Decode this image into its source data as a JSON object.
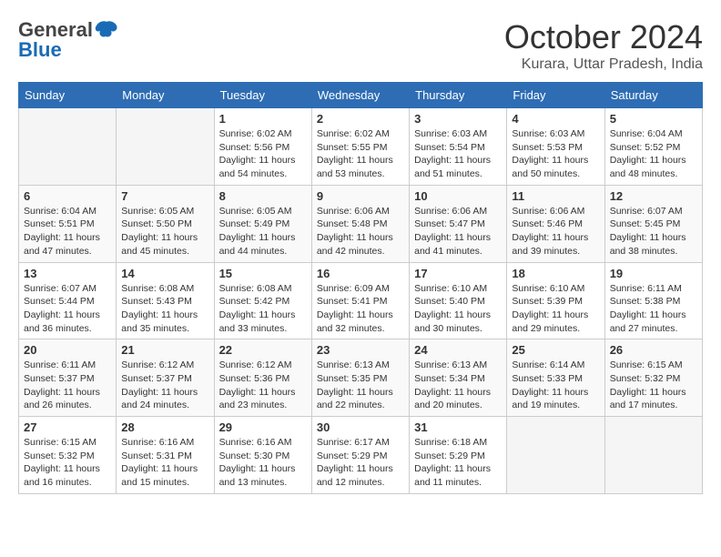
{
  "logo": {
    "general": "General",
    "blue": "Blue"
  },
  "title": "October 2024",
  "location": "Kurara, Uttar Pradesh, India",
  "weekdays": [
    "Sunday",
    "Monday",
    "Tuesday",
    "Wednesday",
    "Thursday",
    "Friday",
    "Saturday"
  ],
  "weeks": [
    [
      {
        "day": "",
        "empty": true
      },
      {
        "day": "",
        "empty": true
      },
      {
        "day": "1",
        "sunrise": "6:02 AM",
        "sunset": "5:56 PM",
        "daylight": "11 hours and 54 minutes."
      },
      {
        "day": "2",
        "sunrise": "6:02 AM",
        "sunset": "5:55 PM",
        "daylight": "11 hours and 53 minutes."
      },
      {
        "day": "3",
        "sunrise": "6:03 AM",
        "sunset": "5:54 PM",
        "daylight": "11 hours and 51 minutes."
      },
      {
        "day": "4",
        "sunrise": "6:03 AM",
        "sunset": "5:53 PM",
        "daylight": "11 hours and 50 minutes."
      },
      {
        "day": "5",
        "sunrise": "6:04 AM",
        "sunset": "5:52 PM",
        "daylight": "11 hours and 48 minutes."
      }
    ],
    [
      {
        "day": "6",
        "sunrise": "6:04 AM",
        "sunset": "5:51 PM",
        "daylight": "11 hours and 47 minutes."
      },
      {
        "day": "7",
        "sunrise": "6:05 AM",
        "sunset": "5:50 PM",
        "daylight": "11 hours and 45 minutes."
      },
      {
        "day": "8",
        "sunrise": "6:05 AM",
        "sunset": "5:49 PM",
        "daylight": "11 hours and 44 minutes."
      },
      {
        "day": "9",
        "sunrise": "6:06 AM",
        "sunset": "5:48 PM",
        "daylight": "11 hours and 42 minutes."
      },
      {
        "day": "10",
        "sunrise": "6:06 AM",
        "sunset": "5:47 PM",
        "daylight": "11 hours and 41 minutes."
      },
      {
        "day": "11",
        "sunrise": "6:06 AM",
        "sunset": "5:46 PM",
        "daylight": "11 hours and 39 minutes."
      },
      {
        "day": "12",
        "sunrise": "6:07 AM",
        "sunset": "5:45 PM",
        "daylight": "11 hours and 38 minutes."
      }
    ],
    [
      {
        "day": "13",
        "sunrise": "6:07 AM",
        "sunset": "5:44 PM",
        "daylight": "11 hours and 36 minutes."
      },
      {
        "day": "14",
        "sunrise": "6:08 AM",
        "sunset": "5:43 PM",
        "daylight": "11 hours and 35 minutes."
      },
      {
        "day": "15",
        "sunrise": "6:08 AM",
        "sunset": "5:42 PM",
        "daylight": "11 hours and 33 minutes."
      },
      {
        "day": "16",
        "sunrise": "6:09 AM",
        "sunset": "5:41 PM",
        "daylight": "11 hours and 32 minutes."
      },
      {
        "day": "17",
        "sunrise": "6:10 AM",
        "sunset": "5:40 PM",
        "daylight": "11 hours and 30 minutes."
      },
      {
        "day": "18",
        "sunrise": "6:10 AM",
        "sunset": "5:39 PM",
        "daylight": "11 hours and 29 minutes."
      },
      {
        "day": "19",
        "sunrise": "6:11 AM",
        "sunset": "5:38 PM",
        "daylight": "11 hours and 27 minutes."
      }
    ],
    [
      {
        "day": "20",
        "sunrise": "6:11 AM",
        "sunset": "5:37 PM",
        "daylight": "11 hours and 26 minutes."
      },
      {
        "day": "21",
        "sunrise": "6:12 AM",
        "sunset": "5:37 PM",
        "daylight": "11 hours and 24 minutes."
      },
      {
        "day": "22",
        "sunrise": "6:12 AM",
        "sunset": "5:36 PM",
        "daylight": "11 hours and 23 minutes."
      },
      {
        "day": "23",
        "sunrise": "6:13 AM",
        "sunset": "5:35 PM",
        "daylight": "11 hours and 22 minutes."
      },
      {
        "day": "24",
        "sunrise": "6:13 AM",
        "sunset": "5:34 PM",
        "daylight": "11 hours and 20 minutes."
      },
      {
        "day": "25",
        "sunrise": "6:14 AM",
        "sunset": "5:33 PM",
        "daylight": "11 hours and 19 minutes."
      },
      {
        "day": "26",
        "sunrise": "6:15 AM",
        "sunset": "5:32 PM",
        "daylight": "11 hours and 17 minutes."
      }
    ],
    [
      {
        "day": "27",
        "sunrise": "6:15 AM",
        "sunset": "5:32 PM",
        "daylight": "11 hours and 16 minutes."
      },
      {
        "day": "28",
        "sunrise": "6:16 AM",
        "sunset": "5:31 PM",
        "daylight": "11 hours and 15 minutes."
      },
      {
        "day": "29",
        "sunrise": "6:16 AM",
        "sunset": "5:30 PM",
        "daylight": "11 hours and 13 minutes."
      },
      {
        "day": "30",
        "sunrise": "6:17 AM",
        "sunset": "5:29 PM",
        "daylight": "11 hours and 12 minutes."
      },
      {
        "day": "31",
        "sunrise": "6:18 AM",
        "sunset": "5:29 PM",
        "daylight": "11 hours and 11 minutes."
      },
      {
        "day": "",
        "empty": true
      },
      {
        "day": "",
        "empty": true
      }
    ]
  ],
  "labels": {
    "sunrise": "Sunrise:",
    "sunset": "Sunset:",
    "daylight": "Daylight:"
  }
}
